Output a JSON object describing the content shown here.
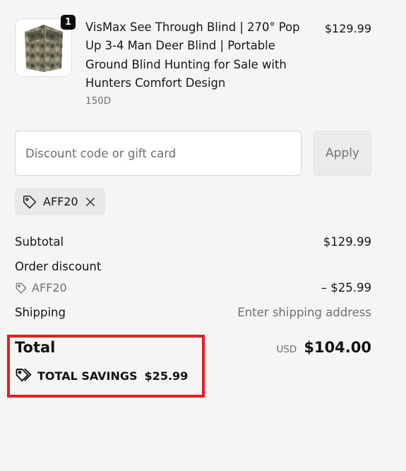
{
  "product": {
    "image_alt": "camouflage pop-up hunting blind",
    "quantity": "1",
    "title": "VisMax See Through Blind | 270° Pop Up 3-4 Man Deer Blind | Portable Ground Blind Hunting for Sale with Hunters Comfort Design",
    "variant": "150D",
    "price": "$129.99"
  },
  "discount": {
    "placeholder": "Discount code or gift card",
    "value": "",
    "apply_label": "Apply",
    "applied_code": "AFF20"
  },
  "summary": {
    "subtotal_label": "Subtotal",
    "subtotal_value": "$129.99",
    "order_discount_label": "Order discount",
    "discount_code": "AFF20",
    "discount_value": "– $25.99",
    "shipping_label": "Shipping",
    "shipping_value": "Enter shipping address",
    "total_label": "Total",
    "currency": "USD",
    "total_value": "$104.00",
    "savings_label": "TOTAL SAVINGS",
    "savings_value": "$25.99"
  },
  "colors": {
    "background": "#f5f5f5",
    "highlight": "#e02020",
    "text": "#111111",
    "muted": "#6f6f6f"
  },
  "icons": {
    "tag": "tag-icon",
    "close": "close-icon",
    "savings": "tags-icon"
  }
}
